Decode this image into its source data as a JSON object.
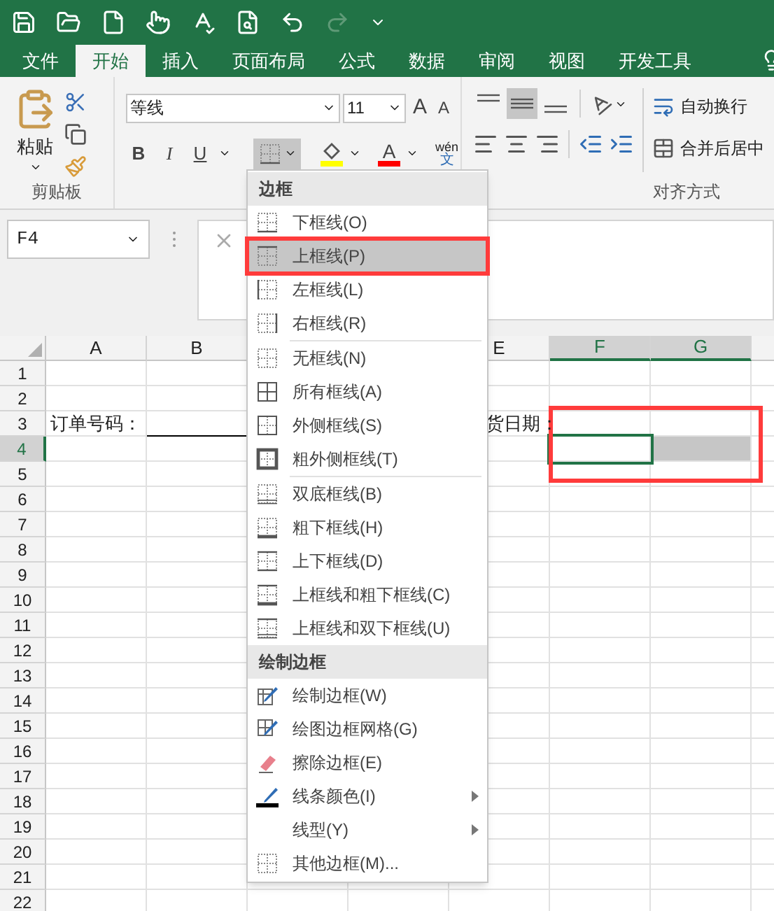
{
  "tabs": [
    {
      "label": "文件",
      "selected": false
    },
    {
      "label": "开始",
      "selected": true
    },
    {
      "label": "插入",
      "selected": false
    },
    {
      "label": "页面布局",
      "selected": false
    },
    {
      "label": "公式",
      "selected": false
    },
    {
      "label": "数据",
      "selected": false
    },
    {
      "label": "审阅",
      "selected": false
    },
    {
      "label": "视图",
      "selected": false
    },
    {
      "label": "开发工具",
      "selected": false
    }
  ],
  "ribbon": {
    "paste_label": "粘贴",
    "clipboard_group": "剪贴板",
    "font_name": "等线",
    "font_size": "11",
    "grow_font": "A",
    "shrink_font": "A",
    "bold": "B",
    "italic": "I",
    "underline": "U",
    "borders_pressed": true,
    "font_color_label": "A",
    "phonetic": {
      "top": "wén",
      "bottom": "文"
    },
    "wrap_text": "自动换行",
    "merge_center": "合并后居中",
    "alignment_group": "对齐方式",
    "middle_align_selected": true
  },
  "name_box": "F4",
  "spreadsheet": {
    "columns": [
      {
        "label": "A",
        "selected": false
      },
      {
        "label": "B",
        "selected": false
      },
      {
        "label": "E",
        "selected": false
      },
      {
        "label": "F",
        "selected": true
      },
      {
        "label": "G",
        "selected": true
      }
    ],
    "rows": [
      {
        "label": "1",
        "selected": false
      },
      {
        "label": "2",
        "selected": false
      },
      {
        "label": "3",
        "selected": false,
        "cells": [
          {
            "text": "订单号码："
          },
          {
            "border_bottom": true
          },
          {
            "text": "货日期："
          },
          {},
          {}
        ]
      },
      {
        "label": "4",
        "selected": true,
        "cells": [
          {},
          {},
          {},
          {
            "active": true
          },
          {
            "in_selection": true
          }
        ]
      },
      {
        "label": "5",
        "selected": false
      },
      {
        "label": "6",
        "selected": false
      },
      {
        "label": "7",
        "selected": false
      },
      {
        "label": "8",
        "selected": false
      },
      {
        "label": "9",
        "selected": false
      },
      {
        "label": "10",
        "selected": false
      },
      {
        "label": "11",
        "selected": false
      },
      {
        "label": "12",
        "selected": false
      },
      {
        "label": "13",
        "selected": false
      },
      {
        "label": "14",
        "selected": false
      },
      {
        "label": "15",
        "selected": false
      },
      {
        "label": "16",
        "selected": false
      },
      {
        "label": "17",
        "selected": false
      },
      {
        "label": "18",
        "selected": false
      },
      {
        "label": "19",
        "selected": false
      },
      {
        "label": "20",
        "selected": false
      },
      {
        "label": "21",
        "selected": false
      },
      {
        "label": "22",
        "selected": false
      }
    ],
    "selection_highlighted": true
  },
  "border_menu": {
    "sections": [
      {
        "title": "边框",
        "items": [
          {
            "label": "下框线(O)",
            "kind": "bottom",
            "highlighted": false
          },
          {
            "label": "上框线(P)",
            "kind": "top",
            "highlighted": true
          },
          {
            "label": "左框线(L)",
            "kind": "left",
            "highlighted": false
          },
          {
            "label": "右框线(R)",
            "kind": "right",
            "highlighted": false
          },
          {
            "label": "无框线(N)",
            "kind": "none",
            "highlighted": false,
            "separator_before": true
          },
          {
            "label": "所有框线(A)",
            "kind": "all",
            "highlighted": false
          },
          {
            "label": "外侧框线(S)",
            "kind": "outside",
            "highlighted": false
          },
          {
            "label": "粗外侧框线(T)",
            "kind": "thick_outside",
            "highlighted": false
          },
          {
            "label": "双底框线(B)",
            "kind": "double_bottom",
            "highlighted": false,
            "separator_before": true
          },
          {
            "label": "粗下框线(H)",
            "kind": "thick_bottom",
            "highlighted": false
          },
          {
            "label": "上下框线(D)",
            "kind": "top_bottom",
            "highlighted": false
          },
          {
            "label": "上框线和粗下框线(C)",
            "kind": "top_thick_bottom",
            "highlighted": false
          },
          {
            "label": "上框线和双下框线(U)",
            "kind": "top_double_bottom",
            "highlighted": false
          }
        ]
      },
      {
        "title": "绘制边框",
        "items": [
          {
            "label": "绘制边框(W)",
            "kind": "draw",
            "highlighted": false
          },
          {
            "label": "绘图边框网格(G)",
            "kind": "draw_grid",
            "highlighted": false
          },
          {
            "label": "擦除边框(E)",
            "kind": "erase",
            "highlighted": false
          },
          {
            "label": "线条颜色(I)",
            "kind": "line_color",
            "highlighted": false,
            "submenu": true
          },
          {
            "label": "线型(Y)",
            "kind": "line_style",
            "highlighted": false,
            "submenu": true
          },
          {
            "label": "其他边框(M)...",
            "kind": "more",
            "highlighted": false
          }
        ]
      }
    ]
  }
}
